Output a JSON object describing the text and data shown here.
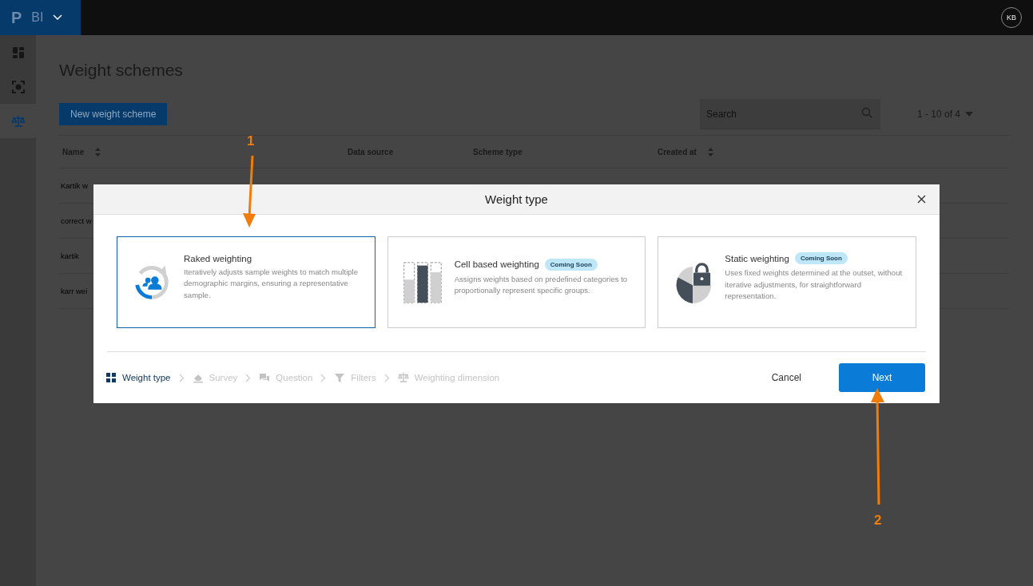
{
  "topbar": {
    "logo": "P",
    "product": "BI",
    "avatar": "KB"
  },
  "sidebar": {
    "items": [
      {
        "selected": false
      },
      {
        "selected": false
      },
      {
        "selected": true
      }
    ]
  },
  "page": {
    "title": "Weight schemes",
    "new_button": "New weight scheme",
    "search": {
      "placeholder": "Search"
    },
    "pagination": "1 - 10 of 4"
  },
  "table": {
    "columns": [
      {
        "label": "Name",
        "sortable": true
      },
      {
        "label": "Data source",
        "sortable": false
      },
      {
        "label": "Scheme type",
        "sortable": false
      },
      {
        "label": "Created at",
        "sortable": true
      }
    ],
    "rows": [
      {
        "name": "Kartik w"
      },
      {
        "name": "correct w"
      },
      {
        "name": "kartik"
      },
      {
        "name": "karr wei"
      }
    ]
  },
  "modal": {
    "title": "Weight type",
    "cards": [
      {
        "kind": "raked",
        "title": "Raked weighting",
        "description": "Iteratively adjusts sample weights to match multiple demographic margins, ensuring a representative sample.",
        "selected": true
      },
      {
        "kind": "cell",
        "title": "Cell based weighting",
        "badge": "Coming Soon",
        "description": "Assigns weights based on predefined categories to proportionally represent specific groups.",
        "selected": false
      },
      {
        "kind": "static",
        "title": "Static weighting",
        "badge": "Coming Soon",
        "description": "Uses fixed weights determined at the outset, without iterative adjustments, for straightforward representation.",
        "selected": false
      }
    ],
    "steps": [
      {
        "label": "Weight type",
        "selected": true
      },
      {
        "label": "Survey",
        "selected": false
      },
      {
        "label": "Question",
        "selected": false
      },
      {
        "label": "Filters",
        "selected": false
      },
      {
        "label": "Weighting dimension",
        "selected": false
      }
    ],
    "cancel": "Cancel",
    "next": "Next"
  },
  "annotations": [
    {
      "label": "1"
    },
    {
      "label": "2"
    }
  ]
}
